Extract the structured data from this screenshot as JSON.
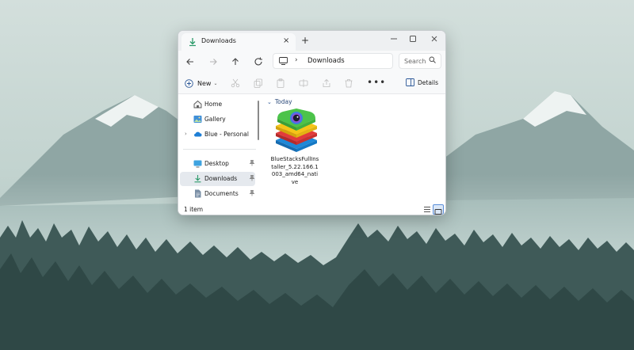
{
  "window": {
    "tab_title": "Downloads",
    "new_tab": "+",
    "close_tab": "×"
  },
  "nav": {
    "address_separator": "›",
    "address_crumb": "Downloads",
    "search_placeholder": "Search"
  },
  "toolbar": {
    "new_label": "New",
    "new_chevron": "⌄",
    "more": "•••",
    "details_label": "Details"
  },
  "sidebar": {
    "items": [
      {
        "label": "Home"
      },
      {
        "label": "Gallery"
      },
      {
        "label": "Blue - Personal",
        "expand": "›"
      },
      {
        "label": "Desktop"
      },
      {
        "label": "Downloads"
      },
      {
        "label": "Documents"
      }
    ]
  },
  "content": {
    "group_chevron": "⌄",
    "group_label": "Today",
    "files": [
      {
        "name": "BlueStacksFullInstaller_5.22.166.1003_amd64_native"
      }
    ]
  },
  "status": {
    "item_count": "1 item"
  },
  "colors": {
    "accent": "#2b5797",
    "selected_bg": "#e5e9ee",
    "window_bg": "#ffffff"
  },
  "icons": {
    "tab": "download-icon",
    "back": "arrow-left-icon",
    "forward": "arrow-right-icon",
    "up": "arrow-up-icon",
    "refresh": "refresh-icon",
    "search": "search-icon",
    "details": "details-pane-icon"
  }
}
